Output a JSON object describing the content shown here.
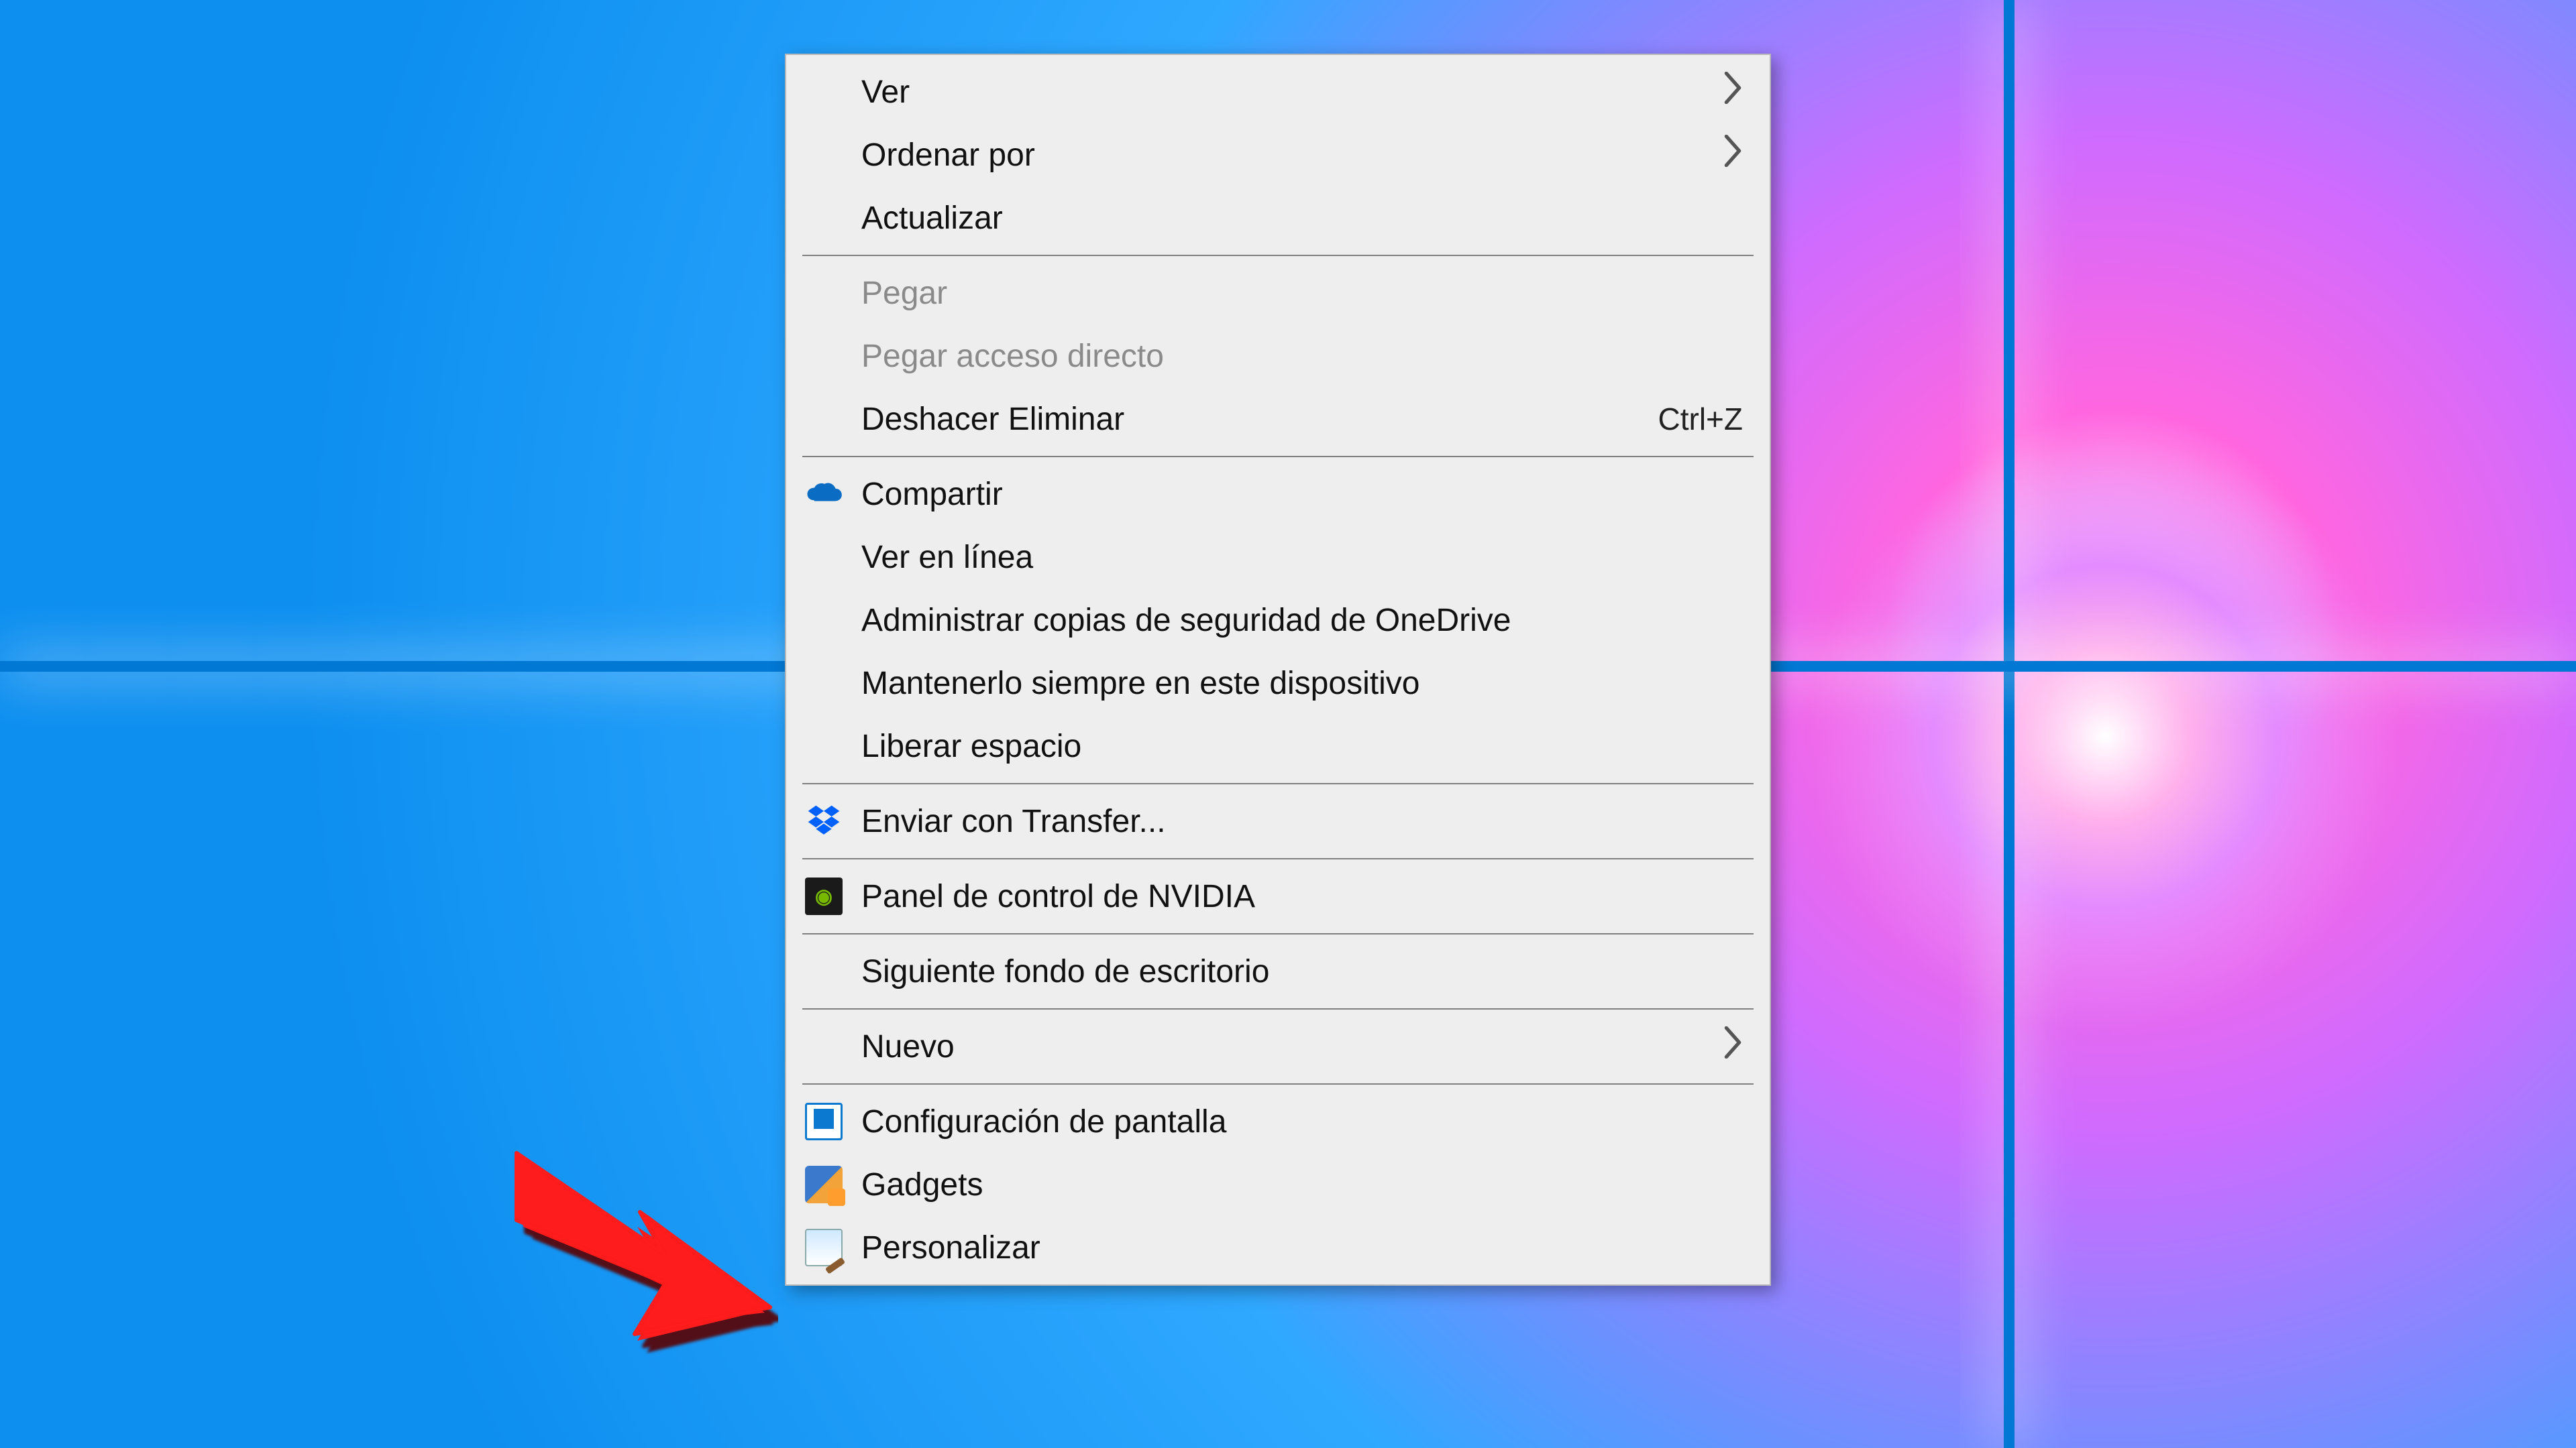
{
  "menu": {
    "items": [
      {
        "label": "Ver",
        "submenu": true
      },
      {
        "label": "Ordenar por",
        "submenu": true
      },
      {
        "label": "Actualizar"
      }
    ],
    "group2": [
      {
        "label": "Pegar",
        "disabled": true
      },
      {
        "label": "Pegar acceso directo",
        "disabled": true
      },
      {
        "label": "Deshacer Eliminar",
        "shortcut": "Ctrl+Z"
      }
    ],
    "group3": [
      {
        "label": "Compartir",
        "icon": "onedrive"
      },
      {
        "label": "Ver en línea"
      },
      {
        "label": "Administrar copias de seguridad de OneDrive"
      },
      {
        "label": "Mantenerlo siempre en este dispositivo"
      },
      {
        "label": "Liberar espacio"
      }
    ],
    "group4": [
      {
        "label": "Enviar con Transfer...",
        "icon": "dropbox"
      }
    ],
    "group5": [
      {
        "label": "Panel de control de NVIDIA",
        "icon": "nvidia"
      }
    ],
    "group6": [
      {
        "label": "Siguiente fondo de escritorio"
      }
    ],
    "group7": [
      {
        "label": "Nuevo",
        "submenu": true
      }
    ],
    "group8": [
      {
        "label": "Configuración de pantalla",
        "icon": "display"
      },
      {
        "label": "Gadgets",
        "icon": "gadgets"
      },
      {
        "label": "Personalizar",
        "icon": "personalize"
      }
    ]
  }
}
